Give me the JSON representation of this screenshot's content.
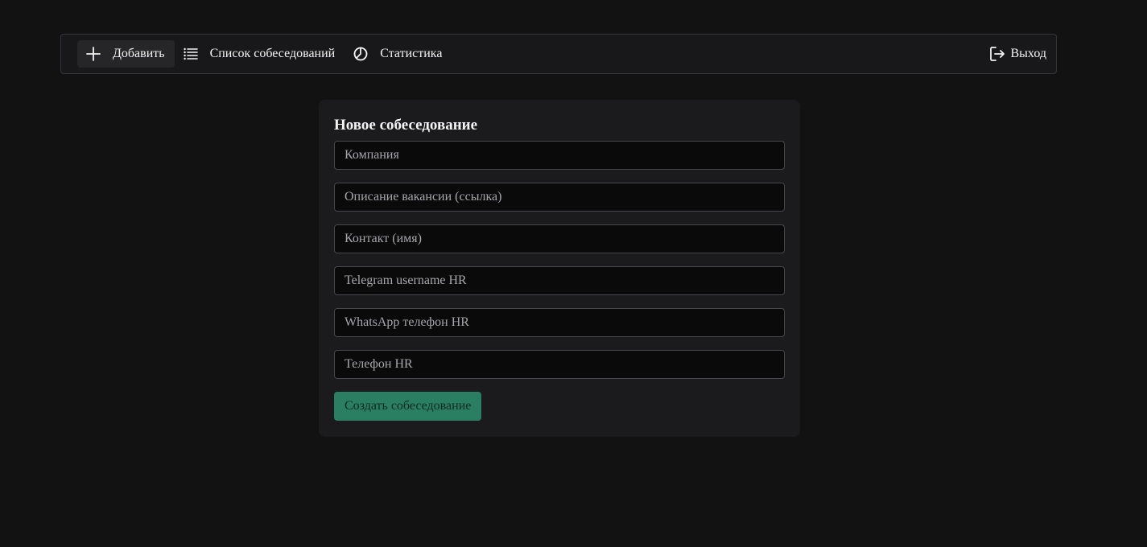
{
  "nav": {
    "items": [
      {
        "label": "Добавить",
        "icon": "plus-icon",
        "active": true
      },
      {
        "label": "Список собеседований",
        "icon": "list-icon",
        "active": false
      },
      {
        "label": "Статистика",
        "icon": "pie-chart-icon",
        "active": false
      }
    ],
    "logout": {
      "label": "Выход",
      "icon": "logout-icon"
    }
  },
  "form": {
    "title": "Новое собеседование",
    "fields": [
      {
        "placeholder": "Компания",
        "value": ""
      },
      {
        "placeholder": "Описание вакансии (ссылка)",
        "value": ""
      },
      {
        "placeholder": "Контакт (имя)",
        "value": ""
      },
      {
        "placeholder": "Telegram username HR",
        "value": ""
      },
      {
        "placeholder": "WhatsApp телефон HR",
        "value": ""
      },
      {
        "placeholder": "Телефон HR",
        "value": ""
      }
    ],
    "submit_label": "Создать собеседование"
  },
  "colors": {
    "background": "#121212",
    "surface": "#1b1b1e",
    "input_bg": "#0a0a0b",
    "accent": "#2a7f62"
  }
}
